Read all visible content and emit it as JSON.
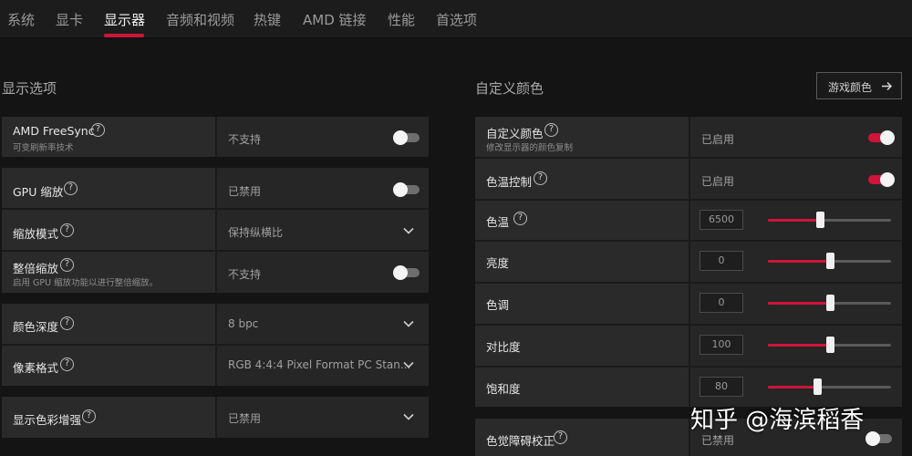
{
  "nav": {
    "tabs": [
      {
        "label": "系统"
      },
      {
        "label": "显卡"
      },
      {
        "label": "显示器"
      },
      {
        "label": "音频和视频"
      },
      {
        "label": "热键"
      },
      {
        "label": "AMD 链接"
      },
      {
        "label": "性能"
      },
      {
        "label": "首选项"
      }
    ],
    "active_tab": "显示器"
  },
  "display_options": {
    "title": "显示选项",
    "freesync": {
      "label": "AMD FreeSync",
      "sub": "可变刷新率技术",
      "value": "不支持",
      "enabled": false
    },
    "gpu_scaling": {
      "label": "GPU 缩放",
      "value": "已禁用",
      "enabled": false
    },
    "scaling_mode": {
      "label": "缩放模式",
      "value": "保持纵横比"
    },
    "integer_scaling": {
      "label": "整倍缩放",
      "sub": "启用 GPU 缩放功能以进行整倍缩放。",
      "value": "不支持",
      "enabled": false
    },
    "color_depth": {
      "label": "颜色深度",
      "value": "8 bpc"
    },
    "pixel_format": {
      "label": "像素格式",
      "value": "RGB 4:4:4 Pixel Format PC Stan..."
    },
    "color_enhance": {
      "label": "显示色彩增强",
      "value": "已禁用"
    }
  },
  "custom_color": {
    "title": "自定义颜色",
    "game_color_button": "游戏颜色",
    "custom_color": {
      "label": "自定义颜色",
      "sub": "修改显示器的颜色复制",
      "value": "已启用",
      "enabled": true
    },
    "temp_control": {
      "label": "色温控制",
      "value": "已启用",
      "enabled": true
    },
    "sliders": [
      {
        "label": "色温",
        "value": "6500",
        "level": 0.42,
        "help": true
      },
      {
        "label": "亮度",
        "value": "0",
        "level": 0.5,
        "help": false
      },
      {
        "label": "色调",
        "value": "0",
        "level": 0.5,
        "help": false
      },
      {
        "label": "对比度",
        "value": "100",
        "level": 0.5,
        "help": false
      },
      {
        "label": "饱和度",
        "value": "80",
        "level": 0.4,
        "help": false
      }
    ],
    "color_blind": {
      "label": "色觉障碍校正",
      "value": "已禁用",
      "enabled": false
    }
  },
  "watermark": "知乎 @海滨稻香",
  "colors": {
    "accent": "#d0143a",
    "panel": "#262626",
    "background": "#141414"
  },
  "icons": {
    "help": "help-icon",
    "chevron": "chevron-down-icon",
    "arrow": "arrow-right-icon"
  }
}
